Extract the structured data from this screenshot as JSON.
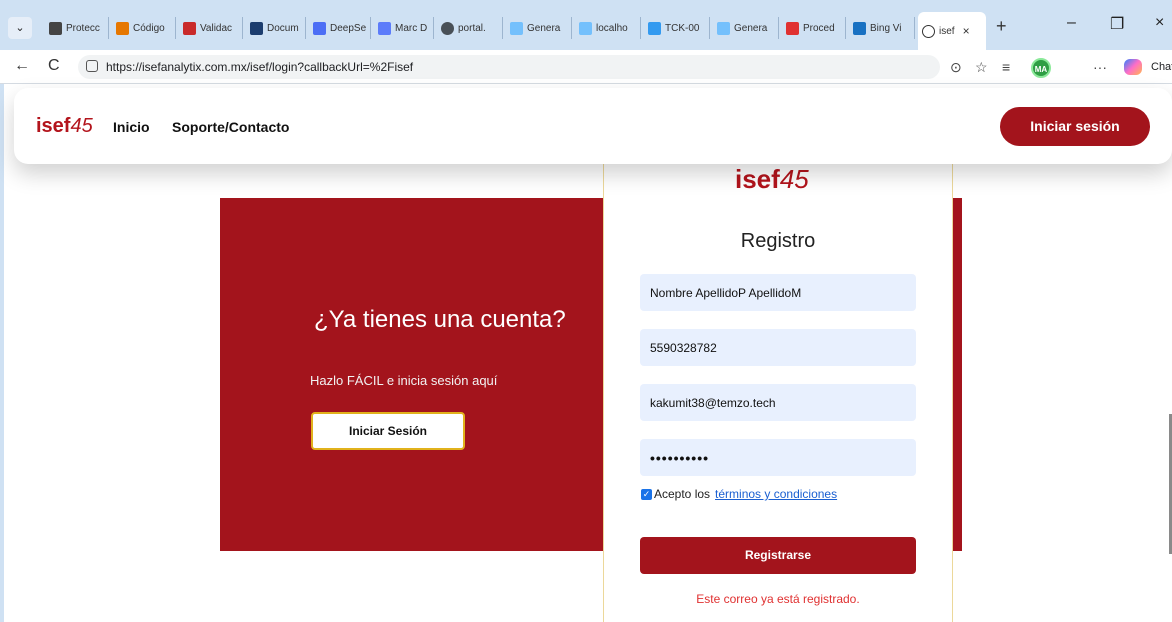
{
  "browser": {
    "tabs": [
      {
        "label": "Protecc",
        "color": "#444444"
      },
      {
        "label": "Código",
        "color": "#e67700"
      },
      {
        "label": "Validac",
        "color": "#c92a2a"
      },
      {
        "label": "Docum",
        "color": "#1c3d6e"
      },
      {
        "label": "DeepSe",
        "color": "#4c6ef5"
      },
      {
        "label": "Marc D",
        "color": "#5c7cfa"
      },
      {
        "label": "portal.",
        "color": "#495057"
      },
      {
        "label": "Genera",
        "color": "#74c0fc"
      },
      {
        "label": "localho",
        "color": "#74c0fc"
      },
      {
        "label": "TCK-00",
        "color": "#339af0"
      },
      {
        "label": "Genera",
        "color": "#74c0fc"
      },
      {
        "label": "Proced",
        "color": "#e03131"
      },
      {
        "label": "Bing Vi",
        "color": "#1971c2"
      }
    ],
    "active_tab": {
      "label": "isef",
      "close": "×"
    },
    "new_tab": "+",
    "window_controls": {
      "minimize": "–",
      "restore": "❐",
      "close": "×"
    },
    "nav": {
      "back": "←",
      "reload": "C"
    },
    "url": "https://isefanalytix.com.mx/isef/login?callbackUrl=%2Fisef",
    "profile_initials": "MA",
    "more": "···",
    "copilot_label": "Chat"
  },
  "header": {
    "logo_text": "isef",
    "logo_num": "45",
    "nav_links": [
      "Inicio",
      "Soporte/Contacto"
    ],
    "login_button": "Iniciar sesión"
  },
  "left_panel": {
    "title": "¿Ya tienes una cuenta?",
    "subtitle": "Hazlo FÁCIL e inicia sesión aquí",
    "button": "Iniciar Sesión"
  },
  "form": {
    "logo_text": "isef",
    "logo_num": "45",
    "title": "Registro",
    "name_value": "Nombre ApellidoP ApellidoM",
    "phone_value": "5590328782",
    "email_value": "kakumit38@temzo.tech",
    "password_value": "••••••••••",
    "terms_prefix": "Acepto los",
    "terms_link": "términos y condiciones",
    "terms_checked": true,
    "submit": "Registrarse",
    "error": "Este correo ya está registrado."
  },
  "colors": {
    "brand_red": "#a3141c",
    "error_red": "#e03131",
    "field_bg": "#e8f0fe"
  }
}
